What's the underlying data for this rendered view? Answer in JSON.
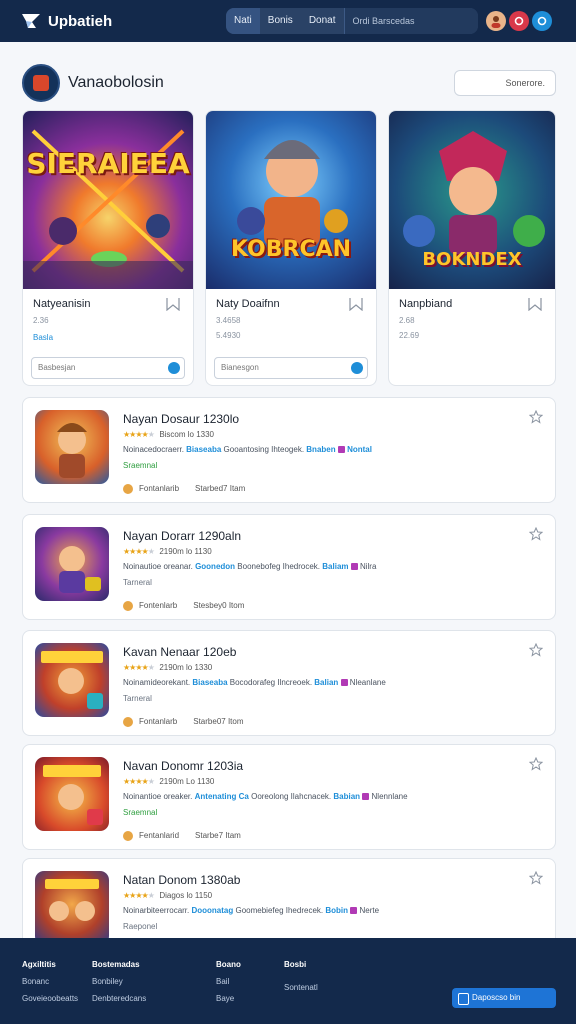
{
  "topbar": {
    "logo_text": "Upbatieh",
    "tabs": [
      "Nati",
      "Bonis",
      "Donat"
    ],
    "search_placeholder": "Ordi  Barscedas",
    "icons": [
      "avatar",
      "notification-icon",
      "help-icon"
    ]
  },
  "page": {
    "title": "Vanaobolosin",
    "sort_label": "Sonerore."
  },
  "featured": [
    {
      "logo": "SIERAIEEA",
      "name": "Natyeanisin",
      "meta": "2.36",
      "tag": "Basla",
      "field_placeholder": "Basbesjan"
    },
    {
      "logo": "KOBRCAN",
      "name": "Naty Doaifnn",
      "meta": "3.4658",
      "tag": "5.4930",
      "field_placeholder": "Bianesgon"
    },
    {
      "logo": "BOKNDEX",
      "name": "Nanpbiand",
      "meta": "2.68",
      "tag": "22.69",
      "field_placeholder": ""
    }
  ],
  "list": [
    {
      "title": "Nayan Dosaur 1230lo",
      "stats": "Biscom  lo  1330",
      "desc_a": "Noinacedocraerr.",
      "hl1": "Biaseaba",
      "desc_b": "Gooantosing Ihteogek.",
      "hl2": "Bnaben",
      "hl3": "Nontal",
      "sub": "Sraemnal",
      "sub_color": "#2e9e3f",
      "foot1": "Fontanlarib",
      "foot2": "Starbed7 Itam"
    },
    {
      "title": "Nayan Dorarr 1290aln",
      "stats": "2190m  lo  1130",
      "desc_a": "Noinautioe oreanar.",
      "hl1": "Goonedon",
      "desc_b": "Boonebofeg Ihedrocek.",
      "hl2": "Baliam",
      "hl3": "Nilra",
      "sub": "Tarneral",
      "sub_color": "#6a7380",
      "foot1": "Fontenlarb",
      "foot2": "Stesbey0 Itom"
    },
    {
      "title": "Kavan Nenaar 120eb",
      "stats": "2190m  lo  1330",
      "desc_a": "Noinamideorekant.",
      "hl1": "Biaseaba",
      "desc_b": "Bocodorafeg Ilncreoek.",
      "hl2": "Balian",
      "hl3": "Nleanlane",
      "sub": "Tarneral",
      "sub_color": "#6a7380",
      "foot1": "Fontanlarb",
      "foot2": "Starbe07 Itom"
    },
    {
      "title": "Navan Donomr 1203ia",
      "stats": "2190m  Lo  1130",
      "desc_a": "Noinantioe oreaker.",
      "hl1": "Antenating Ca",
      "desc_b": "Ooreolong Ilahcnacek.",
      "hl2": "Babian",
      "hl3": "Nlennlane",
      "sub": "Sraemnal",
      "sub_color": "#2e9e3f",
      "foot1": "Fentanlarid",
      "foot2": "Starbe7 Itam"
    },
    {
      "title": "Natan Donom 1380ab",
      "stats": "Diagos  lo  1150",
      "desc_a": "Noinarbiteerrocarr.",
      "hl1": "Dooonatag",
      "desc_b": "Goomebiefeg Ihedrecek.",
      "hl2": "Bobin",
      "hl3": "Nerte",
      "sub": "Raeponel",
      "sub_color": "#6a7380",
      "foot1": "",
      "foot2": ""
    }
  ],
  "footer": {
    "col1": {
      "head": "Agxiltitis",
      "items": [
        "Bonanc",
        "Goveieoobeatts"
      ]
    },
    "col2": {
      "head": "Bostemadas",
      "items": [
        "Bonbiley",
        "Denbteredcans"
      ]
    },
    "col3": {
      "head": "Boano",
      "items": [
        "Bail",
        "Baye"
      ]
    },
    "col4": {
      "head": "Bosbi",
      "items": [
        "Sontenatl"
      ]
    },
    "cta_label": "Daposcso bin"
  },
  "colors": {
    "nav_bg": "#13294b",
    "accent": "#1e8ed8",
    "star": "#e8a317"
  }
}
